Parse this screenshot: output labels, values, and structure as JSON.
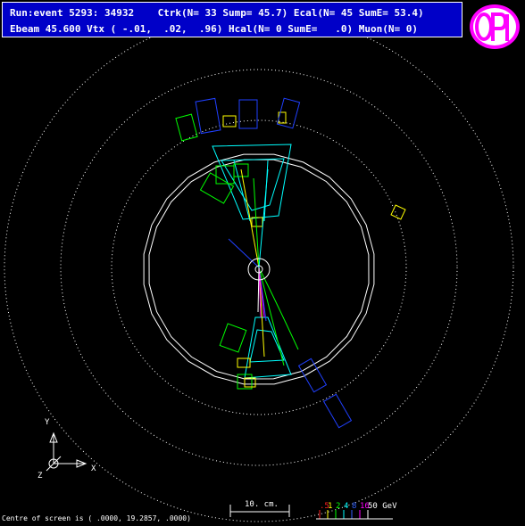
{
  "header": {
    "line1": "Run:event 5293: 34932    Ctrk(N= 33 Sump= 45.7) Ecal(N= 45 SumE= 53.4)",
    "line2": "Ebeam 45.600 Vtx ( -.01,  .02,  .96) Hcal(N= 0 SumE=   .0) Muon(N= 0)"
  },
  "logo": {
    "text": "OPAL",
    "color": "#ff00ff"
  },
  "axes": {
    "y": "Y",
    "x": "X",
    "z": "Z"
  },
  "scale": {
    "label": "10. cm."
  },
  "energy_legend": {
    "items": [
      {
        "label": ".5",
        "color": "#ff2020"
      },
      {
        "label": "1",
        "color": "#ffff00"
      },
      {
        "label": "2",
        "color": "#00ff00"
      },
      {
        "label": "4",
        "color": "#00ffff"
      },
      {
        "label": "8",
        "color": "#3060ff"
      },
      {
        "label": "16",
        "color": "#ff00ff"
      },
      {
        "label": "50 GeV",
        "color": "#ffffff"
      }
    ]
  },
  "footer": {
    "centre": "Centre of screen is (  .0000,  19.2857,   .0000)"
  },
  "colors": {
    "background": "#000000",
    "header_bg": "#0000c8",
    "detector": "#ffffff"
  }
}
